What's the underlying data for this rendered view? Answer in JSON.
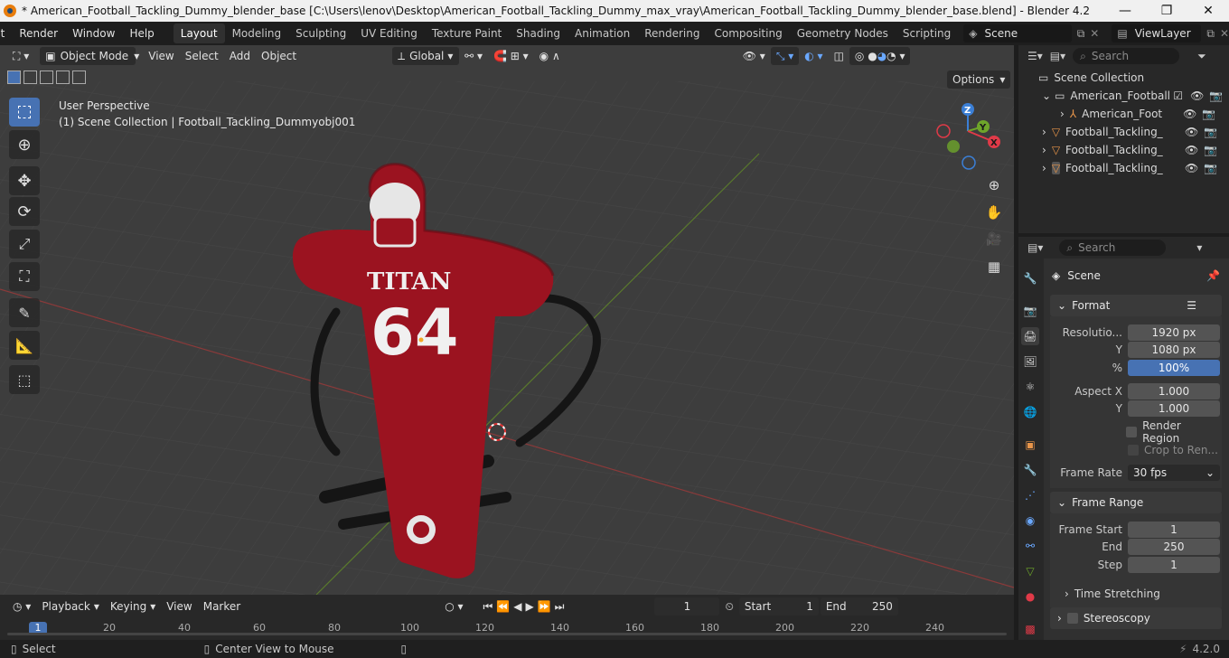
{
  "window": {
    "title": "* American_Football_Tackling_Dummy_blender_base [C:\\Users\\lenov\\Desktop\\American_Football_Tackling_Dummy_max_vray\\American_Football_Tackling_Dummy_blender_base.blend] - Blender 4.2",
    "controls": [
      "—",
      "❐",
      "✕"
    ]
  },
  "menu": {
    "items": [
      "lit",
      "Render",
      "Window",
      "Help"
    ],
    "workspaces": [
      "Layout",
      "Modeling",
      "Sculpting",
      "UV Editing",
      "Texture Paint",
      "Shading",
      "Animation",
      "Rendering",
      "Compositing",
      "Geometry Nodes",
      "Scripting"
    ],
    "active_workspace": "Layout",
    "scene": "Scene",
    "view_layer": "ViewLayer"
  },
  "viewport": {
    "mode": "Object Mode",
    "menus": [
      "View",
      "Select",
      "Add",
      "Object"
    ],
    "orientation": "Global",
    "options": "Options",
    "perspective_label": "User Perspective",
    "context_label": "(1) Scene Collection | Football_Tackling_Dummyobj001",
    "model_text_top": "TITAN",
    "model_text_number": "64",
    "gizmo_axes": [
      "Z",
      "Y",
      "X"
    ]
  },
  "outliner": {
    "search_placeholder": "Search",
    "rows": [
      {
        "label": "Scene Collection",
        "icon": "collection-icon"
      },
      {
        "label": "American_Football",
        "icon": "collection-icon"
      },
      {
        "label": "American_Foot",
        "icon": "armature-icon"
      },
      {
        "label": "Football_Tackling_",
        "icon": "mesh-icon"
      },
      {
        "label": "Football_Tackling_",
        "icon": "mesh-icon"
      },
      {
        "label": "Football_Tackling_",
        "icon": "mesh-icon"
      }
    ]
  },
  "properties": {
    "search_placeholder": "Search",
    "context": "Scene",
    "format_panel": "Format",
    "resolution_label": "Resolutio...",
    "resolution_x": "1920 px",
    "y_label": "Y",
    "resolution_y": "1080 px",
    "percent_label": "%",
    "percent": "100%",
    "aspect_x_label": "Aspect X",
    "aspect_x": "1.000",
    "aspect_y_label": "Y",
    "aspect_y": "1.000",
    "render_region": "Render Region",
    "crop": "Crop to Ren...",
    "frame_rate_label": "Frame Rate",
    "frame_rate": "30 fps",
    "frame_range_panel": "Frame Range",
    "frame_start_label": "Frame Start",
    "frame_start": "1",
    "end_label": "End",
    "end": "250",
    "step_label": "Step",
    "step": "1",
    "time_stretching": "Time Stretching",
    "stereoscopy": "Stereoscopy"
  },
  "timeline": {
    "menus": [
      "Playback",
      "Keying",
      "View",
      "Marker"
    ],
    "current_frame": "1",
    "start_label": "Start",
    "start": "1",
    "end_label": "End",
    "end": "250",
    "ruler": [
      "1",
      "20",
      "40",
      "60",
      "80",
      "100",
      "120",
      "140",
      "160",
      "180",
      "200",
      "220",
      "240"
    ]
  },
  "status": {
    "select": "Select",
    "center_view": "Center View to Mouse",
    "version": "4.2.0"
  }
}
